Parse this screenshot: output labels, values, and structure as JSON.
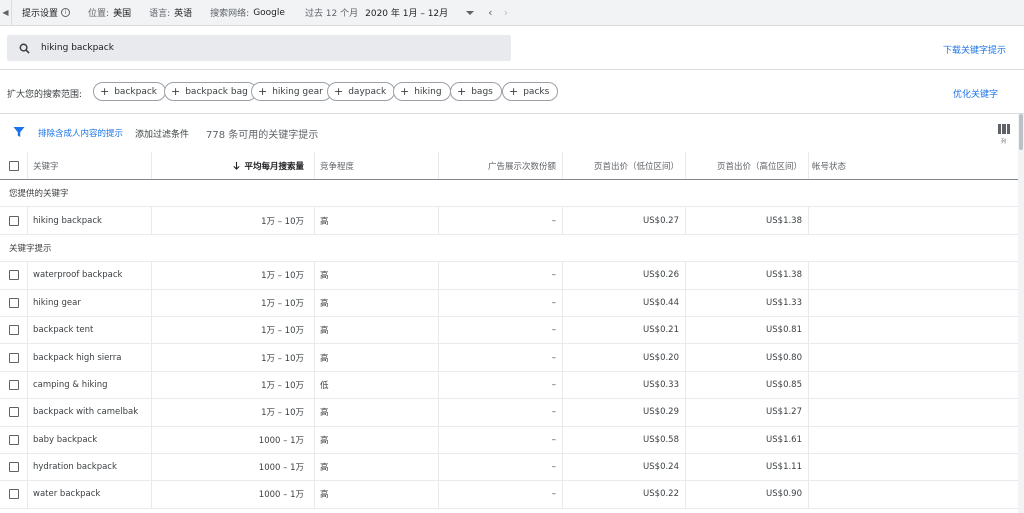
{
  "settings_bar": {
    "title": "提示设置",
    "location_label": "位置:",
    "location_value": "美国",
    "language_label": "语言:",
    "language_value": "英语",
    "network_label": "搜索网络:",
    "network_value": "Google",
    "period_label": "过去 12 个月",
    "period_value": "2020 年 1月 – 12月"
  },
  "search": {
    "value": "hiking backpack"
  },
  "download_link": "下载关键字提示",
  "expand": {
    "label": "扩大您的搜索范围:",
    "chips": [
      "backpack",
      "backpack bag",
      "hiking gear",
      "daypack",
      "hiking",
      "bags",
      "packs"
    ]
  },
  "refine_link": "优化关键字",
  "filters": {
    "exclude_adult": "排除含成人内容的提示",
    "add_filter": "添加过滤条件",
    "count_text": "778 条可用的关键字提示",
    "columns_sub": "列"
  },
  "table": {
    "headers": {
      "keyword": "关键字",
      "volume": "平均每月搜索量",
      "competition": "竞争程度",
      "impression_share": "广告展示次数份额",
      "bid_low": "页首出价（低位区间）",
      "bid_high": "页首出价（高位区间）",
      "account_status": "帐号状态"
    },
    "sections": {
      "provided": "您提供的关键字",
      "ideas": "关键字提示"
    },
    "provided_rows": [
      {
        "keyword": "hiking backpack",
        "volume": "1万 – 10万",
        "competition": "高",
        "impression": "–",
        "low": "US$0.27",
        "high": "US$1.38"
      }
    ],
    "idea_rows": [
      {
        "keyword": "waterproof backpack",
        "volume": "1万 – 10万",
        "competition": "高",
        "impression": "–",
        "low": "US$0.26",
        "high": "US$1.38"
      },
      {
        "keyword": "hiking gear",
        "volume": "1万 – 10万",
        "competition": "高",
        "impression": "–",
        "low": "US$0.44",
        "high": "US$1.33"
      },
      {
        "keyword": "backpack tent",
        "volume": "1万 – 10万",
        "competition": "高",
        "impression": "–",
        "low": "US$0.21",
        "high": "US$0.81"
      },
      {
        "keyword": "backpack high sierra",
        "volume": "1万 – 10万",
        "competition": "高",
        "impression": "–",
        "low": "US$0.20",
        "high": "US$0.80"
      },
      {
        "keyword": "camping & hiking",
        "volume": "1万 – 10万",
        "competition": "低",
        "impression": "–",
        "low": "US$0.33",
        "high": "US$0.85"
      },
      {
        "keyword": "backpack with camelbak",
        "volume": "1万 – 10万",
        "competition": "高",
        "impression": "–",
        "low": "US$0.29",
        "high": "US$1.27"
      },
      {
        "keyword": "baby backpack",
        "volume": "1000 – 1万",
        "competition": "高",
        "impression": "–",
        "low": "US$0.58",
        "high": "US$1.61"
      },
      {
        "keyword": "hydration backpack",
        "volume": "1000 – 1万",
        "competition": "高",
        "impression": "–",
        "low": "US$0.24",
        "high": "US$1.11"
      },
      {
        "keyword": "water backpack",
        "volume": "1000 – 1万",
        "competition": "高",
        "impression": "–",
        "low": "US$0.22",
        "high": "US$0.90"
      }
    ]
  },
  "colors": {
    "accent": "#1a73e8",
    "topbar_bg": "#f1f3f4",
    "search_bg": "#e8eaed"
  },
  "icons": [
    "collapse-arrow-icon",
    "info-icon",
    "dropdown-icon",
    "chevron-left-icon",
    "chevron-right-icon",
    "search-icon",
    "plus-icon",
    "filter-icon",
    "columns-icon",
    "sort-down-icon"
  ]
}
